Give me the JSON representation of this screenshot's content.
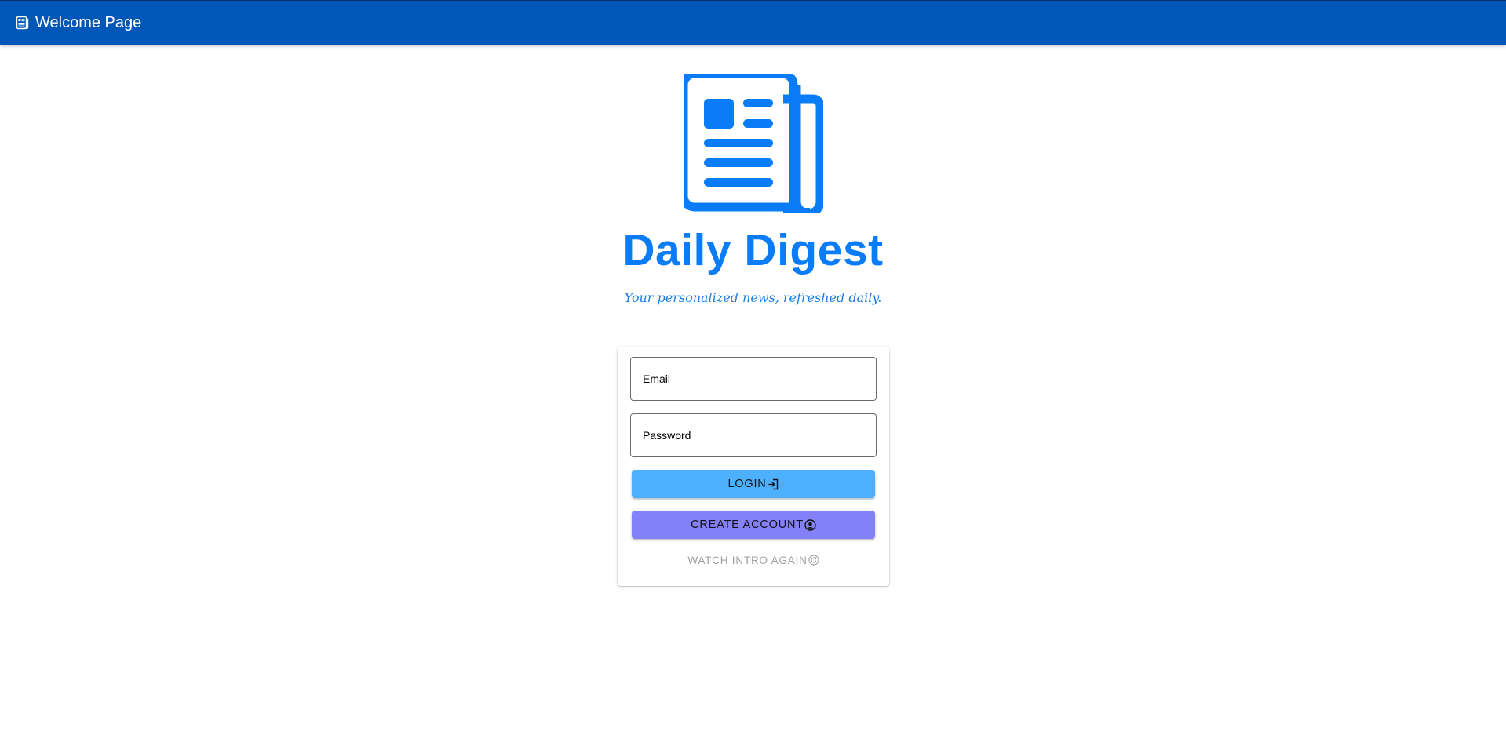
{
  "appbar": {
    "title": "Welcome Page",
    "icon": "newspaper-icon",
    "background": "#0057b8"
  },
  "hero": {
    "logo_icon": "newspaper-icon",
    "brand": "Daily Digest",
    "tagline": "Your personalized news, refreshed daily.",
    "brand_color": "#0a7cf7"
  },
  "login_form": {
    "email_placeholder": "Email",
    "email_value": "",
    "password_placeholder": "Password",
    "password_value": "",
    "login_label": "LOGIN",
    "login_icon": "login-icon",
    "create_label": "CREATE ACCOUNT",
    "create_icon": "account-circle-icon",
    "intro_label": "WATCH INTRO AGAIN",
    "intro_icon": "replay-circle-icon",
    "login_color": "#4db0ff",
    "create_color": "#8480f7"
  }
}
